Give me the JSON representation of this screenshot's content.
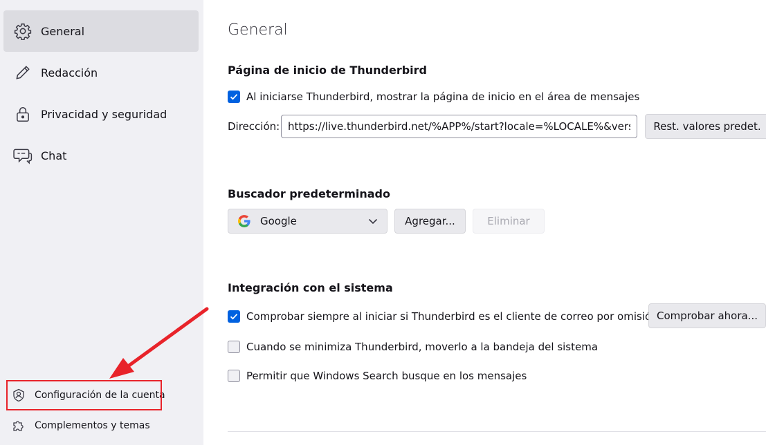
{
  "sidebar": {
    "items": [
      {
        "label": "General",
        "icon": "gear-icon",
        "selected": true
      },
      {
        "label": "Redacción",
        "icon": "pencil-icon",
        "selected": false
      },
      {
        "label": "Privacidad y seguridad",
        "icon": "lock-icon",
        "selected": false
      },
      {
        "label": "Chat",
        "icon": "chat-icon",
        "selected": false
      }
    ],
    "bottom_items": [
      {
        "label": "Configuración de la cuenta",
        "icon": "account-icon"
      },
      {
        "label": "Complementos y temas",
        "icon": "puzzle-icon"
      }
    ]
  },
  "main": {
    "page_title": "General",
    "start_page": {
      "title": "Página de inicio de Thunderbird",
      "show_start_label": "Al iniciarse Thunderbird, mostrar la página de inicio en el área de mensajes",
      "show_start_checked": true,
      "address_label": "Dirección:",
      "address_value": "https://live.thunderbird.net/%APP%/start?locale=%LOCALE%&version",
      "restore_label": "Rest. valores predet."
    },
    "search": {
      "title": "Buscador predeterminado",
      "engine": "Google",
      "add_label": "Agregar...",
      "remove_label": "Eliminar"
    },
    "integration": {
      "title": "Integración con el sistema",
      "default_client_label": "Comprobar siempre al iniciar si Thunderbird es el cliente de correo por omisión",
      "default_client_checked": true,
      "check_now_label": "Comprobar ahora...",
      "minimize_label": "Cuando se minimiza Thunderbird, moverlo a la bandeja del sistema",
      "minimize_checked": false,
      "windows_search_label": "Permitir que Windows Search busque en los mensajes",
      "windows_search_checked": false
    }
  },
  "colors": {
    "accent": "#0061e0",
    "sidebar_bg": "#f0f0f4",
    "annotation": "#e8232a"
  }
}
